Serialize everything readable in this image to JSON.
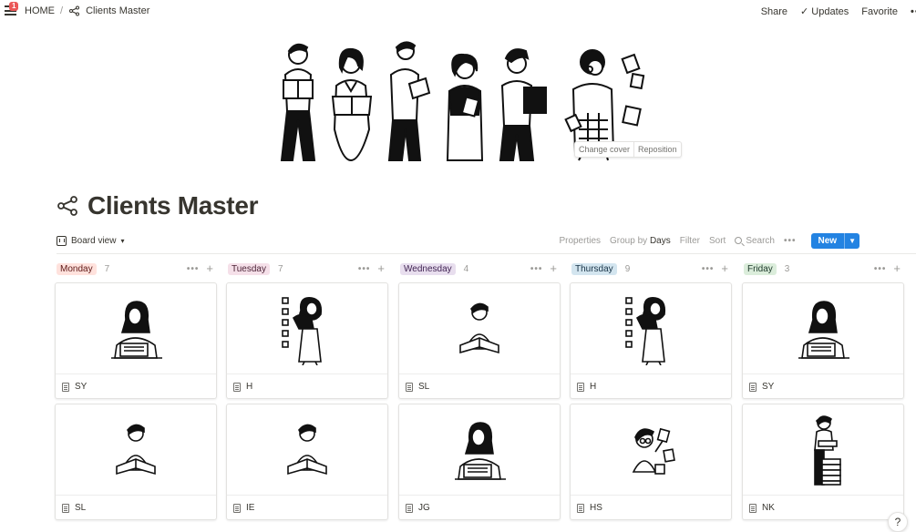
{
  "topbar": {
    "notification_count": "1",
    "breadcrumbs": [
      "HOME",
      "/",
      "Clients Master"
    ],
    "share": "Share",
    "updates": "Updates",
    "favorite": "Favorite"
  },
  "cover": {
    "change_cover": "Change cover",
    "reposition": "Reposition"
  },
  "page": {
    "title": "Clients Master",
    "icon": "share-nodes-icon"
  },
  "viewbar": {
    "view_label": "Board view",
    "properties": "Properties",
    "group_by": "Group by",
    "group_value": "Days",
    "filter": "Filter",
    "sort": "Sort",
    "search": "Search",
    "more": "•••",
    "new": "New"
  },
  "columns": [
    {
      "label": "Monday",
      "count": "7",
      "color": "#ffe2dd",
      "text_color": "#5d1715",
      "cards": [
        {
          "title": "SY",
          "art": "woman-laptop"
        },
        {
          "title": "SL",
          "art": "man-reading"
        }
      ]
    },
    {
      "label": "Tuesday",
      "count": "7",
      "color": "#f5e0e9",
      "text_color": "#4c2337",
      "cards": [
        {
          "title": "H",
          "art": "woman-checklist"
        },
        {
          "title": "IE",
          "art": "man-reading"
        }
      ]
    },
    {
      "label": "Wednesday",
      "count": "4",
      "color": "#e8deee",
      "text_color": "#412454",
      "cards": [
        {
          "title": "SL",
          "art": "man-reading"
        },
        {
          "title": "JG",
          "art": "woman-laptop"
        }
      ]
    },
    {
      "label": "Thursday",
      "count": "9",
      "color": "#d3e5ef",
      "text_color": "#183347",
      "cards": [
        {
          "title": "H",
          "art": "woman-checklist"
        },
        {
          "title": "HS",
          "art": "man-notes"
        }
      ]
    },
    {
      "label": "Friday",
      "count": "3",
      "color": "#dbeddb",
      "text_color": "#1c3829",
      "cards": [
        {
          "title": "SY",
          "art": "woman-laptop"
        },
        {
          "title": "NK",
          "art": "man-books"
        }
      ]
    }
  ],
  "help": "?"
}
